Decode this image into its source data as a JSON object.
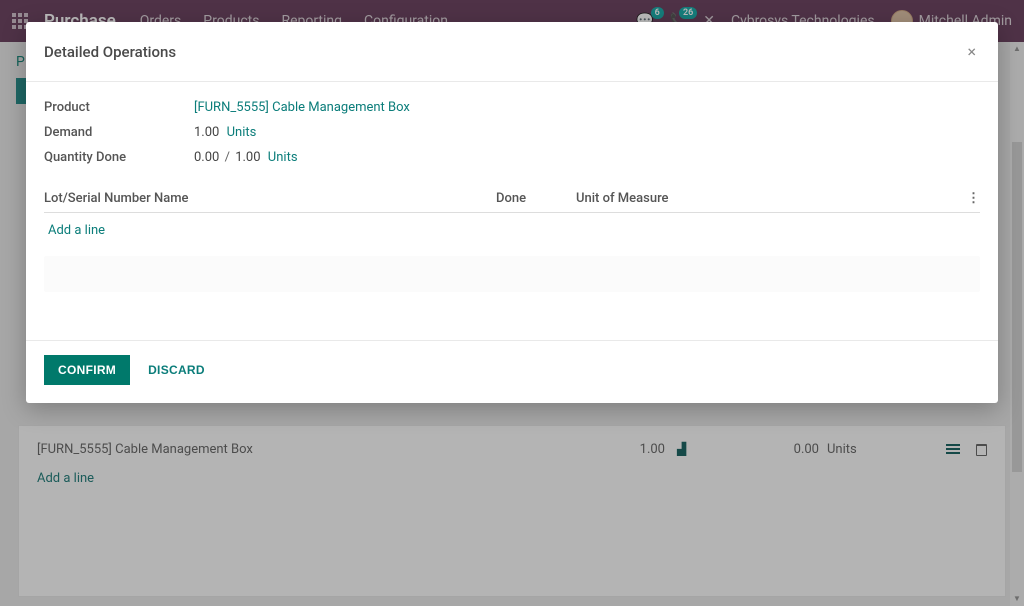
{
  "colors": {
    "brand": "#5a2d4d",
    "teal": "#00796b",
    "link": "#0b7d7a"
  },
  "topbar": {
    "brand": "Purchase",
    "menu": [
      "Orders",
      "Products",
      "Reporting",
      "Configuration"
    ],
    "badge_chat": "6",
    "badge_activity": "26",
    "company": "Cybrosys Technologies",
    "user": "Mitchell Admin"
  },
  "background": {
    "row": {
      "product": "[FURN_5555] Cable Management Box",
      "qty": "1.00",
      "done": "0.00",
      "units": "Units"
    },
    "add_line": "Add a line"
  },
  "modal": {
    "title": "Detailed Operations",
    "labels": {
      "product": "Product",
      "demand": "Demand",
      "qty_done": "Quantity Done"
    },
    "values": {
      "product": "[FURN_5555] Cable Management Box",
      "demand_qty": "1.00",
      "demand_units": "Units",
      "done_qty": "0.00",
      "done_sep": "/",
      "done_total": "1.00",
      "done_units": "Units"
    },
    "table": {
      "th_lot": "Lot/Serial Number Name",
      "th_done": "Done",
      "th_uom": "Unit of Measure",
      "add_line": "Add a line"
    },
    "buttons": {
      "confirm": "CONFIRM",
      "discard": "DISCARD"
    }
  }
}
